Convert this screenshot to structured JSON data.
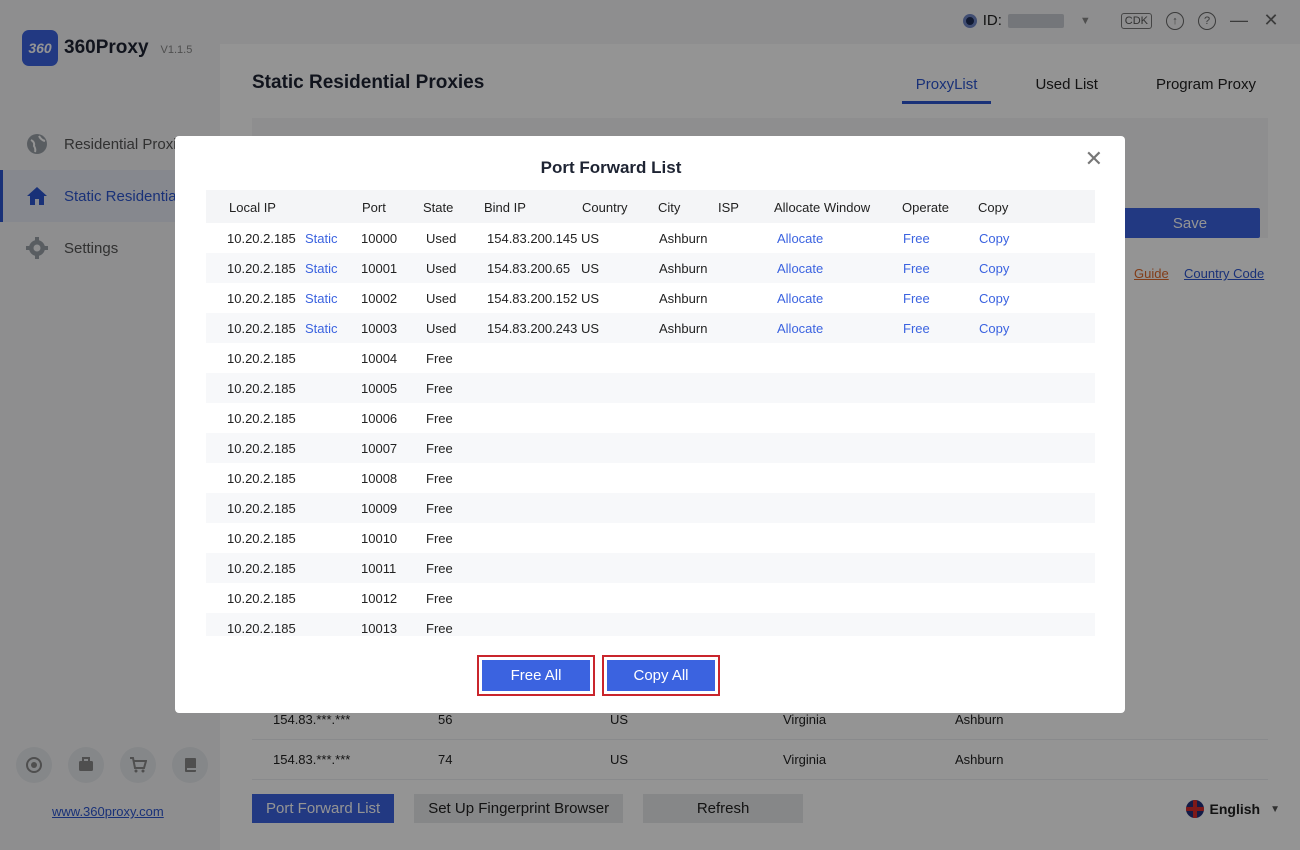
{
  "app": {
    "name": "360Proxy",
    "logo_text": "360",
    "version": "V1.1.5",
    "site": "www.360proxy.com",
    "language": "English"
  },
  "topbar": {
    "id_label": "ID:",
    "cdk": "CDK"
  },
  "sidebar": {
    "items": [
      {
        "label": "Residential Proxi"
      },
      {
        "label": "Static Residentia"
      },
      {
        "label": "Settings"
      }
    ]
  },
  "main": {
    "title": "Static Residential Proxies",
    "tabs": [
      {
        "label": "ProxyList"
      },
      {
        "label": "Used List"
      },
      {
        "label": "Program Proxy"
      }
    ],
    "save": "Save",
    "guide": "Guide",
    "country_code": "Country Code",
    "bg_rows": [
      {
        "ip": "154.83.***.***",
        "num": "56",
        "country": "US",
        "region": "Virginia",
        "city": "Ashburn"
      },
      {
        "ip": "154.83.***.***",
        "num": "74",
        "country": "US",
        "region": "Virginia",
        "city": "Ashburn"
      }
    ],
    "buttons": {
      "port_forward": "Port Forward List",
      "fingerprint": "Set Up Fingerprint Browser",
      "refresh": "Refresh"
    }
  },
  "modal": {
    "title": "Port Forward List",
    "headers": [
      "Local IP",
      "Port",
      "State",
      "Bind IP",
      "Country",
      "City",
      "ISP",
      "Allocate Window",
      "Operate",
      "Copy"
    ],
    "rows": [
      {
        "ip": "10.20.2.185",
        "type": "Static",
        "port": "10000",
        "state": "Used",
        "bind": "154.83.200.145",
        "country": "US",
        "city": "Ashburn",
        "alloc": "Allocate",
        "op": "Free",
        "copy": "Copy"
      },
      {
        "ip": "10.20.2.185",
        "type": "Static",
        "port": "10001",
        "state": "Used",
        "bind": "154.83.200.65",
        "country": "US",
        "city": "Ashburn",
        "alloc": "Allocate",
        "op": "Free",
        "copy": "Copy"
      },
      {
        "ip": "10.20.2.185",
        "type": "Static",
        "port": "10002",
        "state": "Used",
        "bind": "154.83.200.152",
        "country": "US",
        "city": "Ashburn",
        "alloc": "Allocate",
        "op": "Free",
        "copy": "Copy"
      },
      {
        "ip": "10.20.2.185",
        "type": "Static",
        "port": "10003",
        "state": "Used",
        "bind": "154.83.200.243",
        "country": "US",
        "city": "Ashburn",
        "alloc": "Allocate",
        "op": "Free",
        "copy": "Copy"
      },
      {
        "ip": "10.20.2.185",
        "port": "10004",
        "state": "Free"
      },
      {
        "ip": "10.20.2.185",
        "port": "10005",
        "state": "Free"
      },
      {
        "ip": "10.20.2.185",
        "port": "10006",
        "state": "Free"
      },
      {
        "ip": "10.20.2.185",
        "port": "10007",
        "state": "Free"
      },
      {
        "ip": "10.20.2.185",
        "port": "10008",
        "state": "Free"
      },
      {
        "ip": "10.20.2.185",
        "port": "10009",
        "state": "Free"
      },
      {
        "ip": "10.20.2.185",
        "port": "10010",
        "state": "Free"
      },
      {
        "ip": "10.20.2.185",
        "port": "10011",
        "state": "Free"
      },
      {
        "ip": "10.20.2.185",
        "port": "10012",
        "state": "Free"
      },
      {
        "ip": "10.20.2.185",
        "port": "10013",
        "state": "Free"
      }
    ],
    "free_all": "Free All",
    "copy_all": "Copy All"
  }
}
